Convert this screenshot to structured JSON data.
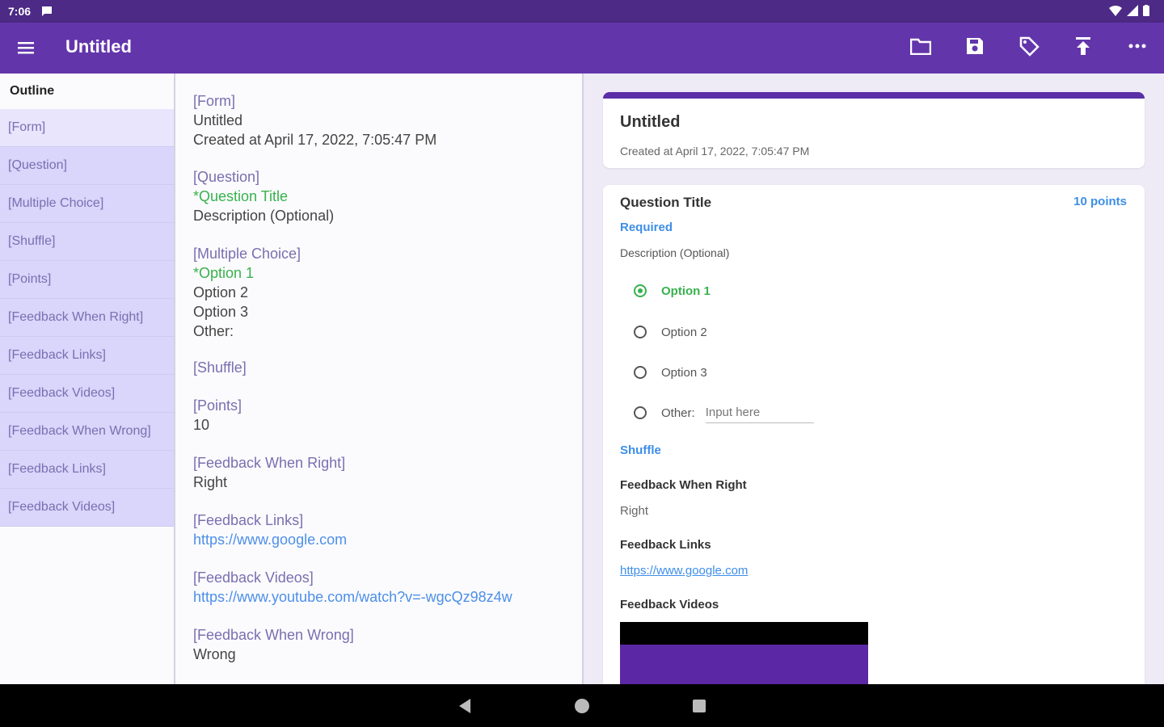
{
  "status": {
    "time": "7:06"
  },
  "app": {
    "title": "Untitled"
  },
  "toolbar": {
    "icons": [
      "folder-icon",
      "save-icon",
      "tag-icon",
      "upload-icon",
      "more-icon"
    ]
  },
  "outline": {
    "header": "Outline",
    "items": [
      "[Form]",
      "[Question]",
      "[Multiple Choice]",
      "[Shuffle]",
      "[Points]",
      "[Feedback When Right]",
      "[Feedback Links]",
      "[Feedback Videos]",
      "[Feedback When Wrong]",
      "[Feedback Links]",
      "[Feedback Videos]"
    ]
  },
  "source": {
    "form_tag": "[Form]",
    "form_title": "Untitled",
    "form_created": "Created at April 17, 2022, 7:05:47 PM",
    "question_tag": "[Question]",
    "question_title": "*Question Title",
    "question_desc": "Description (Optional)",
    "mc_tag": "[Multiple Choice]",
    "mc_opt1": "*Option 1",
    "mc_opt2": "Option 2",
    "mc_opt3": "Option 3",
    "mc_other": "Other:",
    "shuffle_tag": "[Shuffle]",
    "points_tag": "[Points]",
    "points_value": "10",
    "fb_right_tag": "[Feedback When Right]",
    "fb_right_value": "Right",
    "fb_links_tag": "[Feedback Links]",
    "fb_links_value": "https://www.google.com",
    "fb_videos_tag": "[Feedback Videos]",
    "fb_videos_value": "https://www.youtube.com/watch?v=-wgcQz98z4w",
    "fb_wrong_tag": "[Feedback When Wrong]",
    "fb_wrong_value": "Wrong"
  },
  "preview": {
    "title": "Untitled",
    "created": "Created at April 17, 2022, 7:05:47 PM",
    "question_title": "Question Title",
    "points": "10 points",
    "required": "Required",
    "description": "Description (Optional)",
    "options": [
      "Option 1",
      "Option 2",
      "Option 3"
    ],
    "other_label": "Other:",
    "other_placeholder": "Input here",
    "shuffle": "Shuffle",
    "fb_right_label": "Feedback When Right",
    "fb_right_value": "Right",
    "fb_links_label": "Feedback Links",
    "fb_links_value": "https://www.google.com",
    "fb_videos_label": "Feedback Videos"
  },
  "colors": {
    "status_bar": "#4c2a85",
    "app_bar": "#6335ab",
    "outline_bg": "#d9d5fb",
    "accent_green": "#37b24d",
    "accent_blue": "#3d8ee8"
  }
}
